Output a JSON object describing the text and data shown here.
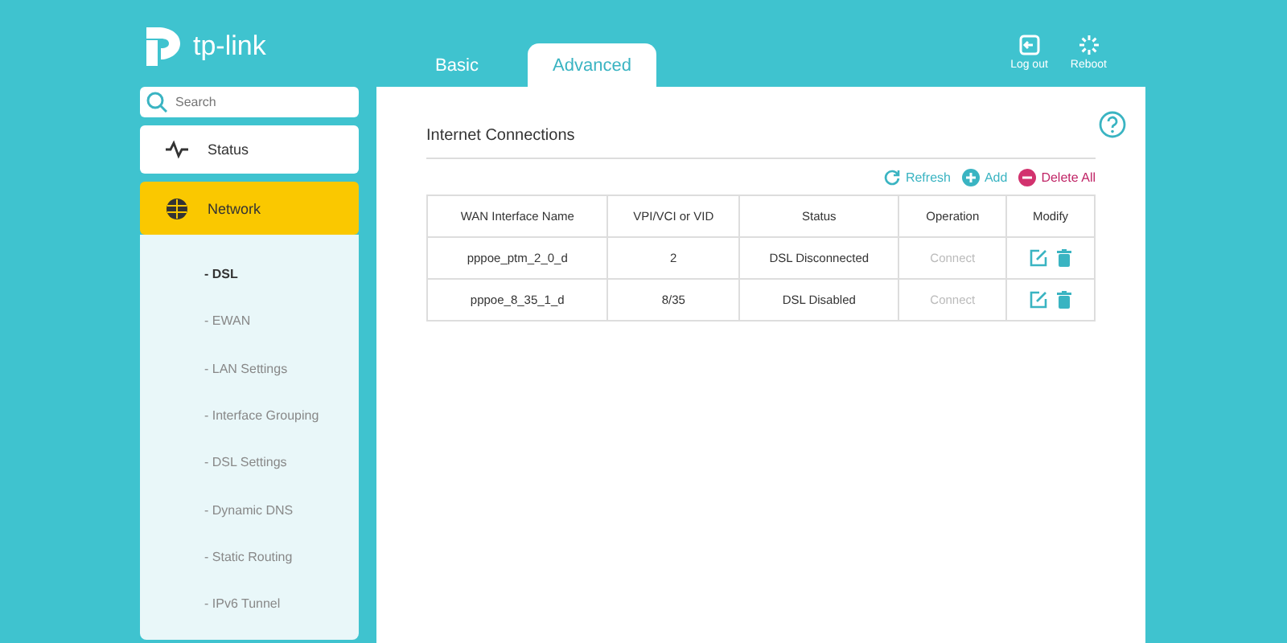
{
  "header": {
    "logo": "tp-link",
    "tabs": [
      {
        "label": "Basic",
        "selected": false
      },
      {
        "label": "Advanced",
        "selected": true
      }
    ],
    "actions": [
      {
        "kind": "logout",
        "label": "Log out"
      },
      {
        "kind": "reboot",
        "label": "Reboot"
      }
    ]
  },
  "sidebar": {
    "search": {
      "placeholder": "Search"
    },
    "items": [
      {
        "kind": "status",
        "label": "Status",
        "selected": false
      },
      {
        "kind": "network",
        "label": "Network",
        "selected": true,
        "expanded": true,
        "children": [
          {
            "label": "- DSL",
            "selected": true
          },
          {
            "label": "- EWAN",
            "selected": false
          },
          {
            "label": "- LAN Settings",
            "selected": false
          },
          {
            "label": "- Interface Grouping",
            "selected": false
          },
          {
            "label": "- DSL Settings",
            "selected": false
          },
          {
            "label": "- Dynamic DNS",
            "selected": false
          },
          {
            "label": "- Static Routing",
            "selected": false
          },
          {
            "label": "- IPv6 Tunnel",
            "selected": false
          }
        ]
      }
    ]
  },
  "main": {
    "title": "Internet Connections",
    "toolbar": [
      {
        "kind": "refresh",
        "label": "Refresh"
      },
      {
        "kind": "add",
        "label": "Add"
      },
      {
        "kind": "delete",
        "label": "Delete All"
      }
    ],
    "table": {
      "columns": [
        "WAN Interface Name",
        "VPI/VCI or VID",
        "Status",
        "Operation",
        "Modify"
      ],
      "rows": [
        {
          "name": "pppoe_ptm_2_0_d",
          "vid": "2",
          "status": "DSL Disconnected",
          "operation": "Connect",
          "operation_disabled": true
        },
        {
          "name": "pppoe_8_35_1_d",
          "vid": "8/35",
          "status": "DSL Disabled",
          "operation": "Connect",
          "operation_disabled": true
        }
      ]
    }
  }
}
